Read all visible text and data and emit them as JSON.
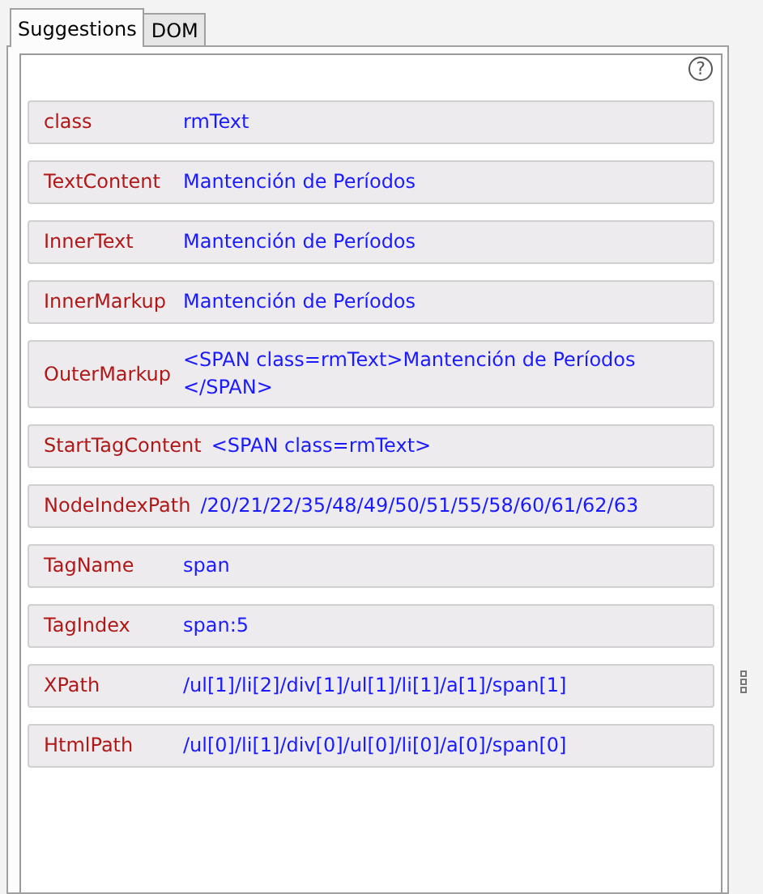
{
  "tabs": [
    {
      "label": "Suggestions",
      "selected": true
    },
    {
      "label": "DOM",
      "selected": false
    }
  ],
  "help": "?",
  "properties": [
    {
      "name": "class",
      "value": "rmText"
    },
    {
      "name": "TextContent",
      "value": "Mantención de Períodos"
    },
    {
      "name": "InnerText",
      "value": "Mantención de Períodos"
    },
    {
      "name": "InnerMarkup",
      "value": "Mantención de Períodos"
    },
    {
      "name": "OuterMarkup",
      "value": "<SPAN class=rmText>Mantención de Períodos</SPAN>"
    },
    {
      "name": "StartTagContent",
      "value": "<SPAN class=rmText>"
    },
    {
      "name": "NodeIndexPath",
      "value": "/20/21/22/35/48/49/50/51/55/58/60/61/62/63"
    },
    {
      "name": "TagName",
      "value": "span"
    },
    {
      "name": "TagIndex",
      "value": "span:5"
    },
    {
      "name": "XPath",
      "value": "/ul[1]/li[2]/div[1]/ul[1]/li[1]/a[1]/span[1]"
    },
    {
      "name": "HtmlPath",
      "value": "/ul[0]/li[1]/div[0]/ul[0]/li[0]/a[0]/span[0]"
    }
  ]
}
